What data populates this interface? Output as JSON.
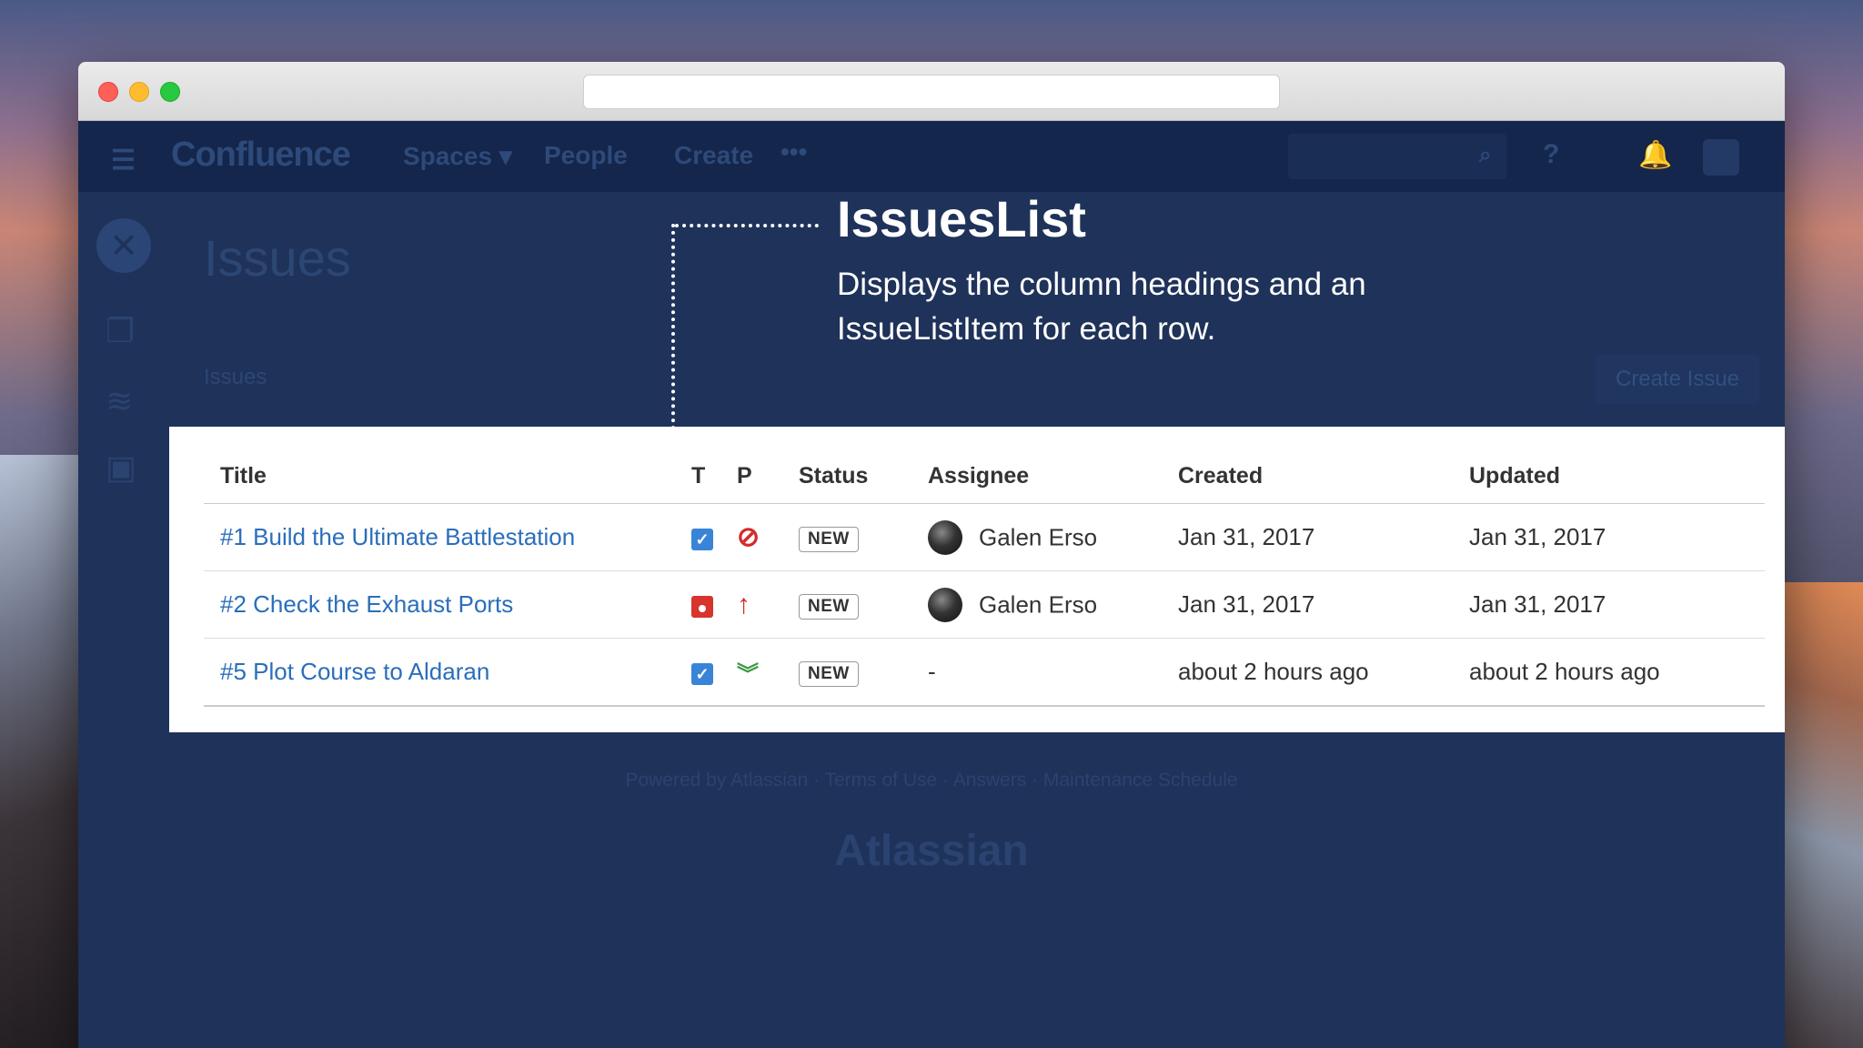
{
  "navbar": {
    "logo": "Confluence",
    "spaces": "Spaces ▾",
    "people": "People",
    "create": "Create",
    "more": "•••",
    "help": "?",
    "bell": "🔔"
  },
  "page": {
    "title": "Issues",
    "section_label": "Issues",
    "create_issue_button": "Create Issue"
  },
  "annotation": {
    "title": "IssuesList",
    "description": "Displays the column headings and an IssueListItem for each row."
  },
  "table": {
    "columns": [
      "Title",
      "T",
      "P",
      "Status",
      "Assignee",
      "Created",
      "Updated"
    ],
    "rows": [
      {
        "title": "#1 Build the Ultimate Battlestation",
        "type": "task",
        "priority": "blocker",
        "status": "NEW",
        "assignee": "Galen Erso",
        "created": "Jan 31, 2017",
        "updated": "Jan 31, 2017"
      },
      {
        "title": "#2 Check the Exhaust Ports",
        "type": "bug",
        "priority": "high",
        "status": "NEW",
        "assignee": "Galen Erso",
        "created": "Jan 31, 2017",
        "updated": "Jan 31, 2017"
      },
      {
        "title": "#5 Plot Course to Aldaran",
        "type": "task",
        "priority": "low",
        "status": "NEW",
        "assignee": "-",
        "created": "about 2 hours ago",
        "updated": "about 2 hours ago"
      }
    ]
  },
  "footer": {
    "links": "Powered by Atlassian  ·  Terms of Use  ·  Answers  ·  Maintenance Schedule",
    "logo": "Atlassian"
  },
  "colors": {
    "overlay": "#1f3259",
    "link": "#2a6ebb",
    "task": "#3a84d8",
    "bug": "#d8342e",
    "priority_high": "#d52a2a",
    "priority_low": "#3b9a44"
  }
}
